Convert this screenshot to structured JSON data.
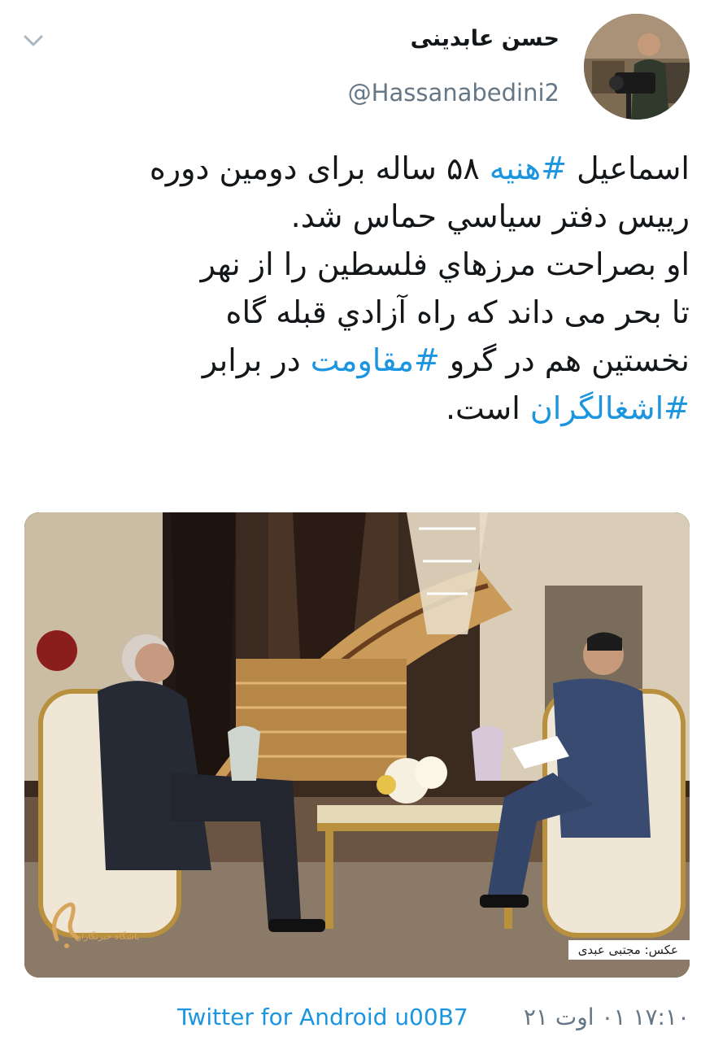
{
  "header": {
    "display_name": "حسن عابدینی",
    "handle": "@Hassanabedini2",
    "menu_icon": "chevron-down-icon",
    "avatar_icon": "profile-photo"
  },
  "tweet": {
    "lines": [
      [
        "اسماعیل ",
        "#هنیه",
        " ۵۸ ساله برای دومین دوره"
      ],
      [
        "رییس دفتر سیاسي حماس شد."
      ],
      [
        "او بصراحت مرزهاي فلسطین را از نهر"
      ],
      [
        "تا بحر می داند که راه آزادي قبله گاه"
      ],
      [
        "نخستین هم در گرو ",
        "#مقاومت",
        " در برابر"
      ],
      [
        "#اشغالگران",
        " است."
      ]
    ]
  },
  "media": {
    "logo_text": "باشگاه خبرنگاران",
    "credit": "عکس: مجتبی عبدی"
  },
  "footer": {
    "timestamp": "۱۷:۱۰ ۰۱ اوت ۲۱",
    "separator": "u00B7",
    "source": "Twitter for Android"
  },
  "colors": {
    "link": "#1b95e0",
    "secondary_text": "#657786",
    "primary_text": "#14171a"
  }
}
